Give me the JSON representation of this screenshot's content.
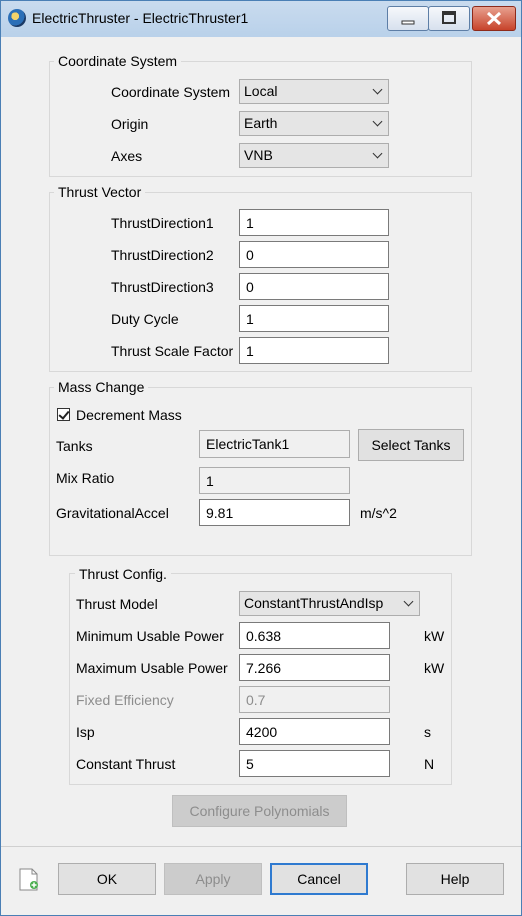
{
  "window": {
    "title": "ElectricThruster - ElectricThruster1"
  },
  "coordinate_system": {
    "group_label": "Coordinate System",
    "coord_label": "Coordinate System",
    "coord_value": "Local",
    "origin_label": "Origin",
    "origin_value": "Earth",
    "axes_label": "Axes",
    "axes_value": "VNB"
  },
  "thrust_vector": {
    "group_label": "Thrust Vector",
    "dir1_label": "ThrustDirection1",
    "dir1_value": "1",
    "dir2_label": "ThrustDirection2",
    "dir2_value": "0",
    "dir3_label": "ThrustDirection3",
    "dir3_value": "0",
    "duty_label": "Duty Cycle",
    "duty_value": "1",
    "scale_label": "Thrust Scale Factor",
    "scale_value": "1"
  },
  "mass_change": {
    "group_label": "Mass Change",
    "decrement_label": "Decrement Mass",
    "decrement_checked": true,
    "tanks_label": "Tanks",
    "tanks_value": "ElectricTank1",
    "select_tanks_label": "Select Tanks",
    "mix_label": "Mix Ratio",
    "mix_value": "1",
    "grav_label": "GravitationalAccel",
    "grav_value": "9.81",
    "grav_unit": "m/s^2"
  },
  "thrust_config": {
    "group_label": "Thrust Config.",
    "model_label": "Thrust Model",
    "model_value": "ConstantThrustAndIsp",
    "min_power_label": "Minimum Usable Power",
    "min_power_value": "0.638",
    "min_power_unit": "kW",
    "max_power_label": "Maximum Usable Power",
    "max_power_value": "7.266",
    "max_power_unit": "kW",
    "eff_label": "Fixed Efficiency",
    "eff_value": "0.7",
    "isp_label": "Isp",
    "isp_value": "4200",
    "isp_unit": "s",
    "thrust_label": "Constant Thrust",
    "thrust_value": "5",
    "thrust_unit": "N",
    "configure_label": "Configure Polynomials"
  },
  "footer": {
    "ok_label": "OK",
    "apply_label": "Apply",
    "cancel_label": "Cancel",
    "help_label": "Help"
  },
  "icons": {
    "app": "globe-icon",
    "minimize": "minimize-icon",
    "maximize": "maximize-icon",
    "close": "close-icon",
    "script": "new-document-icon"
  },
  "colors": {
    "close_button": "#c7432b",
    "default_button_border": "#2f7ad0",
    "titlebar": "#b9d1ea"
  }
}
